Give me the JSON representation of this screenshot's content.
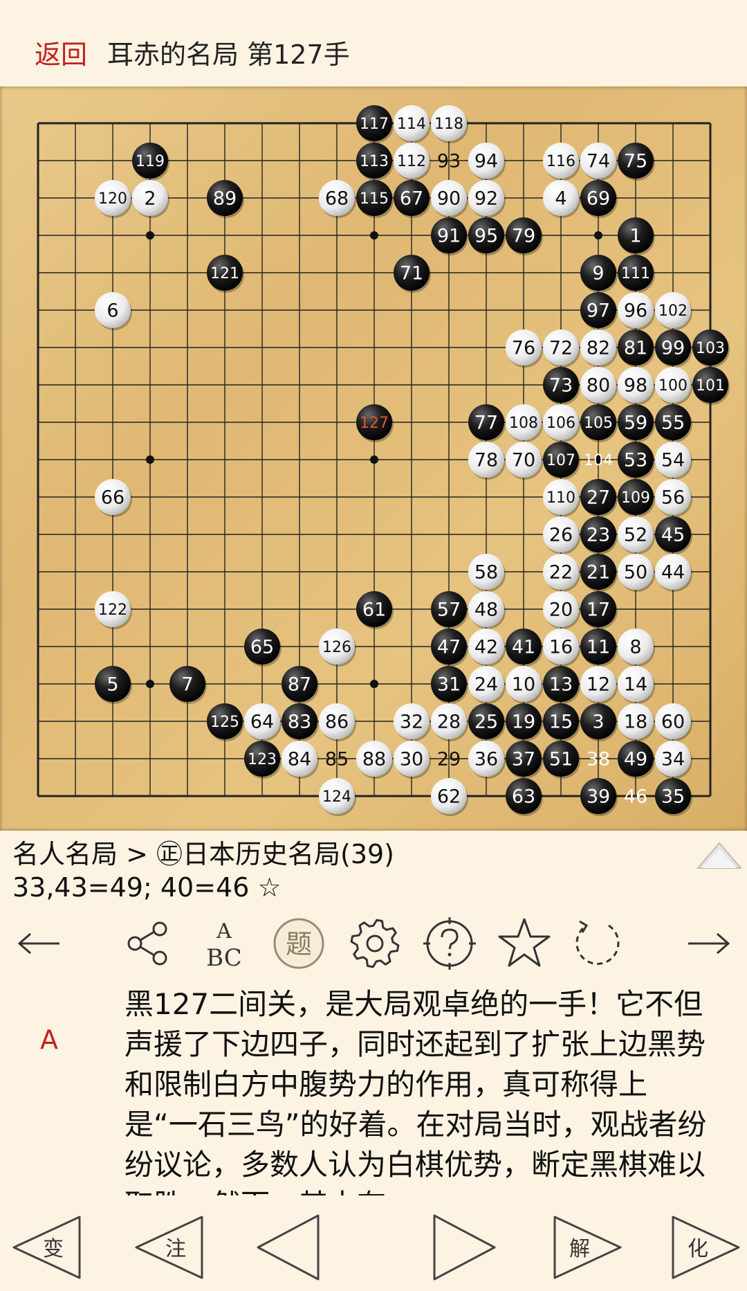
{
  "header": {
    "back_label": "返回",
    "title": "耳赤的名局 第127手"
  },
  "board": {
    "size": 19,
    "last_move": "127",
    "last_move_color": "#e0543a",
    "stones": [
      {
        "c": "B",
        "col": 9,
        "row": 0,
        "n": "117"
      },
      {
        "c": "W",
        "col": 10,
        "row": 0,
        "n": "114"
      },
      {
        "c": "W",
        "col": 11,
        "row": 0,
        "n": "118"
      },
      {
        "c": "B",
        "col": 3,
        "row": 1,
        "n": "119"
      },
      {
        "c": "B",
        "col": 9,
        "row": 1,
        "n": "113"
      },
      {
        "c": "W",
        "col": 10,
        "row": 1,
        "n": "112"
      },
      {
        "c": "M",
        "col": 11,
        "row": 1,
        "n": "93"
      },
      {
        "c": "W",
        "col": 12,
        "row": 1,
        "n": "94"
      },
      {
        "c": "W",
        "col": 14,
        "row": 1,
        "n": "116"
      },
      {
        "c": "W",
        "col": 15,
        "row": 1,
        "n": "74"
      },
      {
        "c": "B",
        "col": 16,
        "row": 1,
        "n": "75"
      },
      {
        "c": "W",
        "col": 2,
        "row": 2,
        "n": "120"
      },
      {
        "c": "W",
        "col": 3,
        "row": 2,
        "n": "2"
      },
      {
        "c": "B",
        "col": 5,
        "row": 2,
        "n": "89"
      },
      {
        "c": "W",
        "col": 8,
        "row": 2,
        "n": "68"
      },
      {
        "c": "B",
        "col": 9,
        "row": 2,
        "n": "115"
      },
      {
        "c": "B",
        "col": 10,
        "row": 2,
        "n": "67"
      },
      {
        "c": "W",
        "col": 11,
        "row": 2,
        "n": "90"
      },
      {
        "c": "W",
        "col": 12,
        "row": 2,
        "n": "92"
      },
      {
        "c": "W",
        "col": 14,
        "row": 2,
        "n": "4"
      },
      {
        "c": "B",
        "col": 15,
        "row": 2,
        "n": "69"
      },
      {
        "c": "B",
        "col": 11,
        "row": 3,
        "n": "91"
      },
      {
        "c": "B",
        "col": 12,
        "row": 3,
        "n": "95"
      },
      {
        "c": "B",
        "col": 13,
        "row": 3,
        "n": "79"
      },
      {
        "c": "B",
        "col": 16,
        "row": 3,
        "n": "1"
      },
      {
        "c": "B",
        "col": 5,
        "row": 4,
        "n": "121"
      },
      {
        "c": "B",
        "col": 10,
        "row": 4,
        "n": "71"
      },
      {
        "c": "B",
        "col": 15,
        "row": 4,
        "n": "9"
      },
      {
        "c": "B",
        "col": 16,
        "row": 4,
        "n": "111"
      },
      {
        "c": "W",
        "col": 2,
        "row": 5,
        "n": "6"
      },
      {
        "c": "B",
        "col": 15,
        "row": 5,
        "n": "97"
      },
      {
        "c": "W",
        "col": 16,
        "row": 5,
        "n": "96"
      },
      {
        "c": "W",
        "col": 17,
        "row": 5,
        "n": "102"
      },
      {
        "c": "W",
        "col": 13,
        "row": 6,
        "n": "76"
      },
      {
        "c": "W",
        "col": 14,
        "row": 6,
        "n": "72"
      },
      {
        "c": "W",
        "col": 15,
        "row": 6,
        "n": "82"
      },
      {
        "c": "B",
        "col": 16,
        "row": 6,
        "n": "81"
      },
      {
        "c": "B",
        "col": 17,
        "row": 6,
        "n": "99"
      },
      {
        "c": "B",
        "col": 18,
        "row": 6,
        "n": "103"
      },
      {
        "c": "B",
        "col": 14,
        "row": 7,
        "n": "73"
      },
      {
        "c": "W",
        "col": 15,
        "row": 7,
        "n": "80"
      },
      {
        "c": "W",
        "col": 16,
        "row": 7,
        "n": "98"
      },
      {
        "c": "W",
        "col": 17,
        "row": 7,
        "n": "100"
      },
      {
        "c": "B",
        "col": 18,
        "row": 7,
        "n": "101"
      },
      {
        "c": "B",
        "col": 9,
        "row": 8,
        "n": "127"
      },
      {
        "c": "B",
        "col": 12,
        "row": 8,
        "n": "77"
      },
      {
        "c": "W",
        "col": 13,
        "row": 8,
        "n": "108"
      },
      {
        "c": "W",
        "col": 14,
        "row": 8,
        "n": "106"
      },
      {
        "c": "B",
        "col": 15,
        "row": 8,
        "n": "105"
      },
      {
        "c": "B",
        "col": 16,
        "row": 8,
        "n": "59"
      },
      {
        "c": "B",
        "col": 17,
        "row": 8,
        "n": "55"
      },
      {
        "c": "W",
        "col": 12,
        "row": 9,
        "n": "78"
      },
      {
        "c": "W",
        "col": 13,
        "row": 9,
        "n": "70"
      },
      {
        "c": "B",
        "col": 14,
        "row": 9,
        "n": "107"
      },
      {
        "c": "N",
        "col": 15,
        "row": 9,
        "n": "104"
      },
      {
        "c": "B",
        "col": 16,
        "row": 9,
        "n": "53"
      },
      {
        "c": "W",
        "col": 17,
        "row": 9,
        "n": "54"
      },
      {
        "c": "W",
        "col": 2,
        "row": 10,
        "n": "66"
      },
      {
        "c": "W",
        "col": 14,
        "row": 10,
        "n": "110"
      },
      {
        "c": "B",
        "col": 15,
        "row": 10,
        "n": "27"
      },
      {
        "c": "B",
        "col": 16,
        "row": 10,
        "n": "109"
      },
      {
        "c": "W",
        "col": 17,
        "row": 10,
        "n": "56"
      },
      {
        "c": "W",
        "col": 14,
        "row": 11,
        "n": "26"
      },
      {
        "c": "B",
        "col": 15,
        "row": 11,
        "n": "23"
      },
      {
        "c": "W",
        "col": 16,
        "row": 11,
        "n": "52"
      },
      {
        "c": "B",
        "col": 17,
        "row": 11,
        "n": "45"
      },
      {
        "c": "W",
        "col": 12,
        "row": 12,
        "n": "58"
      },
      {
        "c": "W",
        "col": 14,
        "row": 12,
        "n": "22"
      },
      {
        "c": "B",
        "col": 15,
        "row": 12,
        "n": "21"
      },
      {
        "c": "W",
        "col": 16,
        "row": 12,
        "n": "50"
      },
      {
        "c": "W",
        "col": 17,
        "row": 12,
        "n": "44"
      },
      {
        "c": "W",
        "col": 2,
        "row": 13,
        "n": "122"
      },
      {
        "c": "B",
        "col": 9,
        "row": 13,
        "n": "61"
      },
      {
        "c": "B",
        "col": 11,
        "row": 13,
        "n": "57"
      },
      {
        "c": "W",
        "col": 12,
        "row": 13,
        "n": "48"
      },
      {
        "c": "W",
        "col": 14,
        "row": 13,
        "n": "20"
      },
      {
        "c": "B",
        "col": 15,
        "row": 13,
        "n": "17"
      },
      {
        "c": "B",
        "col": 6,
        "row": 14,
        "n": "65"
      },
      {
        "c": "W",
        "col": 8,
        "row": 14,
        "n": "126"
      },
      {
        "c": "B",
        "col": 11,
        "row": 14,
        "n": "47"
      },
      {
        "c": "W",
        "col": 12,
        "row": 14,
        "n": "42"
      },
      {
        "c": "B",
        "col": 13,
        "row": 14,
        "n": "41"
      },
      {
        "c": "W",
        "col": 14,
        "row": 14,
        "n": "16"
      },
      {
        "c": "B",
        "col": 15,
        "row": 14,
        "n": "11"
      },
      {
        "c": "W",
        "col": 16,
        "row": 14,
        "n": "8"
      },
      {
        "c": "B",
        "col": 2,
        "row": 15,
        "n": "5"
      },
      {
        "c": "B",
        "col": 4,
        "row": 15,
        "n": "7"
      },
      {
        "c": "B",
        "col": 7,
        "row": 15,
        "n": "87"
      },
      {
        "c": "B",
        "col": 11,
        "row": 15,
        "n": "31"
      },
      {
        "c": "W",
        "col": 12,
        "row": 15,
        "n": "24"
      },
      {
        "c": "W",
        "col": 13,
        "row": 15,
        "n": "10"
      },
      {
        "c": "B",
        "col": 14,
        "row": 15,
        "n": "13"
      },
      {
        "c": "W",
        "col": 15,
        "row": 15,
        "n": "12"
      },
      {
        "c": "W",
        "col": 16,
        "row": 15,
        "n": "14"
      },
      {
        "c": "B",
        "col": 5,
        "row": 16,
        "n": "125"
      },
      {
        "c": "W",
        "col": 6,
        "row": 16,
        "n": "64"
      },
      {
        "c": "B",
        "col": 7,
        "row": 16,
        "n": "83"
      },
      {
        "c": "W",
        "col": 8,
        "row": 16,
        "n": "86"
      },
      {
        "c": "W",
        "col": 10,
        "row": 16,
        "n": "32"
      },
      {
        "c": "W",
        "col": 11,
        "row": 16,
        "n": "28"
      },
      {
        "c": "B",
        "col": 12,
        "row": 16,
        "n": "25"
      },
      {
        "c": "B",
        "col": 13,
        "row": 16,
        "n": "19"
      },
      {
        "c": "B",
        "col": 14,
        "row": 16,
        "n": "15"
      },
      {
        "c": "B",
        "col": 15,
        "row": 16,
        "n": "3"
      },
      {
        "c": "W",
        "col": 16,
        "row": 16,
        "n": "18"
      },
      {
        "c": "W",
        "col": 17,
        "row": 16,
        "n": "60"
      },
      {
        "c": "B",
        "col": 6,
        "row": 17,
        "n": "123"
      },
      {
        "c": "W",
        "col": 7,
        "row": 17,
        "n": "84"
      },
      {
        "c": "M",
        "col": 8,
        "row": 17,
        "n": "85"
      },
      {
        "c": "W",
        "col": 9,
        "row": 17,
        "n": "88"
      },
      {
        "c": "W",
        "col": 10,
        "row": 17,
        "n": "30"
      },
      {
        "c": "M",
        "col": 11,
        "row": 17,
        "n": "29"
      },
      {
        "c": "W",
        "col": 12,
        "row": 17,
        "n": "36"
      },
      {
        "c": "B",
        "col": 13,
        "row": 17,
        "n": "37"
      },
      {
        "c": "B",
        "col": 14,
        "row": 17,
        "n": "51"
      },
      {
        "c": "N",
        "col": 15,
        "row": 17,
        "n": "38"
      },
      {
        "c": "B",
        "col": 16,
        "row": 17,
        "n": "49"
      },
      {
        "c": "W",
        "col": 17,
        "row": 17,
        "n": "34"
      },
      {
        "c": "W",
        "col": 8,
        "row": 18,
        "n": "124"
      },
      {
        "c": "W",
        "col": 11,
        "row": 18,
        "n": "62"
      },
      {
        "c": "B",
        "col": 13,
        "row": 18,
        "n": "63"
      },
      {
        "c": "B",
        "col": 15,
        "row": 18,
        "n": "39"
      },
      {
        "c": "N",
        "col": 16,
        "row": 18,
        "n": "46"
      },
      {
        "c": "B",
        "col": 17,
        "row": 18,
        "n": "35"
      }
    ]
  },
  "info": {
    "line1": "名人名局 > ㊣日本历史名局(39)",
    "line2": "33,43=49; 40=46 ☆"
  },
  "toolbar": {
    "icons": [
      "prev-arrow-icon",
      "share-icon",
      "abc-icon",
      "problem-icon",
      "gear-icon",
      "help-icon",
      "star-icon",
      "rotate-icon",
      "next-arrow-icon"
    ],
    "abc_top": "A",
    "abc_bottom": "BC",
    "problem_char": "题"
  },
  "comment": {
    "marker": "A",
    "text": "黑127二间关，是大局观卓绝的一手！它不但声援了下边四子，同时还起到了扩张上边黑势和限制白方中腹势力的作用，真可称得上是“一石三鸟”的好着。在对局当时，观战者纷纷议论，多数人认为白棋优势，断定黑棋难以取胜。然而，其中有"
  },
  "bottom": {
    "variation": "变",
    "annotate": "注",
    "solve": "解",
    "change": "化"
  }
}
